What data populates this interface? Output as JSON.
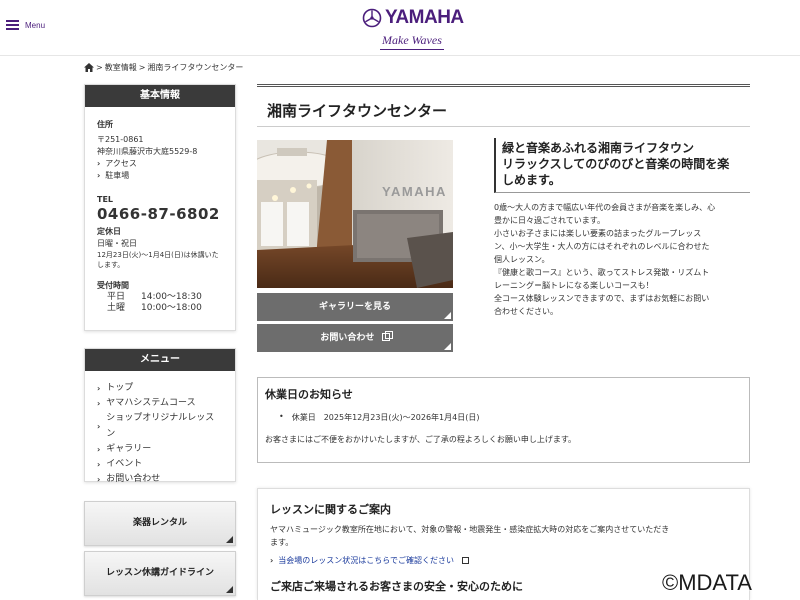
{
  "header": {
    "menu_label": "Menu",
    "logo_text": "YAMAHA",
    "logo_tagline": "Make Waves"
  },
  "breadcrumb": {
    "items": [
      "教室情報",
      "湘南ライフタウンセンター"
    ],
    "separator": ">"
  },
  "basic_info": {
    "heading": "基本情報",
    "address_label": "住所",
    "postal": "〒251-0861",
    "address": "神奈川県藤沢市大庭5529-8",
    "links": [
      "アクセス",
      "駐車場"
    ],
    "tel_label": "TEL",
    "tel": "0466-87-6802",
    "holiday_label": "定休日",
    "holidays": "日曜・祝日",
    "holiday_note": "12月23日(火)～1月4日(日)は休講いたします。",
    "hours_label": "受付時間",
    "hours": [
      {
        "day": "平日",
        "time": "14:00～18:30"
      },
      {
        "day": "土曜",
        "time": "10:00～18:00"
      }
    ]
  },
  "menu": {
    "heading": "メニュー",
    "items": [
      "トップ",
      "ヤマハシステムコース",
      "ショップオリジナルレッスン",
      "ギャラリー",
      "イベント",
      "お問い合わせ"
    ]
  },
  "side_buttons": [
    "楽器レンタル",
    "レッスン休講ガイドライン"
  ],
  "main": {
    "title": "湘南ライフタウンセンター",
    "photo_sign": "YAMAHA",
    "gallery_button": "ギャラリーを見る",
    "contact_button": "お問い合わせ",
    "lead_lines": [
      "緑と音楽あふれる湘南ライフタウン",
      "リラックスしてのびのびと音楽の時間を楽",
      "しめます。"
    ],
    "description_lines": [
      "0歳～大人の方まで幅広い年代の会員さまが音楽を楽しみ、心",
      "豊かに日々過ごされています。",
      "小さいお子さまには楽しい要素の詰まったグループレッス",
      "ン、小～大学生・大人の方にはそれぞれのレベルに合わせた",
      "個人レッスン。",
      "『健康と歌コース』という、歌ってストレス発散・リズムト",
      "レーニング＝脳トレになる楽しいコースも！",
      "全コース体験レッスンできますので、まずはお気軽にお問い",
      "合わせください。"
    ]
  },
  "notice": {
    "title": "休業日のお知らせ",
    "item_label": "休業日",
    "item_value": "2025年12月23日(火)～2026年1月4日(日)",
    "text": "お客さまにはご不便をおかけいたしますが、ご了承の程よろしくお願い申し上げます。"
  },
  "lesson_info": {
    "title": "レッスンに関するご案内",
    "text_lines": [
      "ヤマハミュージック教室所在地において、対象の警報・地震発生・感染症拡大時の対応をご案内させていただき",
      "ます。"
    ],
    "link": "当会場のレッスン状況はこちらでご確認ください",
    "subtitle": "ご来店ご来場されるお客さまの安全・安心のために"
  },
  "watermark": "©MDATA",
  "colors": {
    "brand": "#4b1e7c",
    "dark_header": "#3a3a3a",
    "gray_button": "#6d6d6d",
    "link_blue": "#1a3a9c"
  }
}
